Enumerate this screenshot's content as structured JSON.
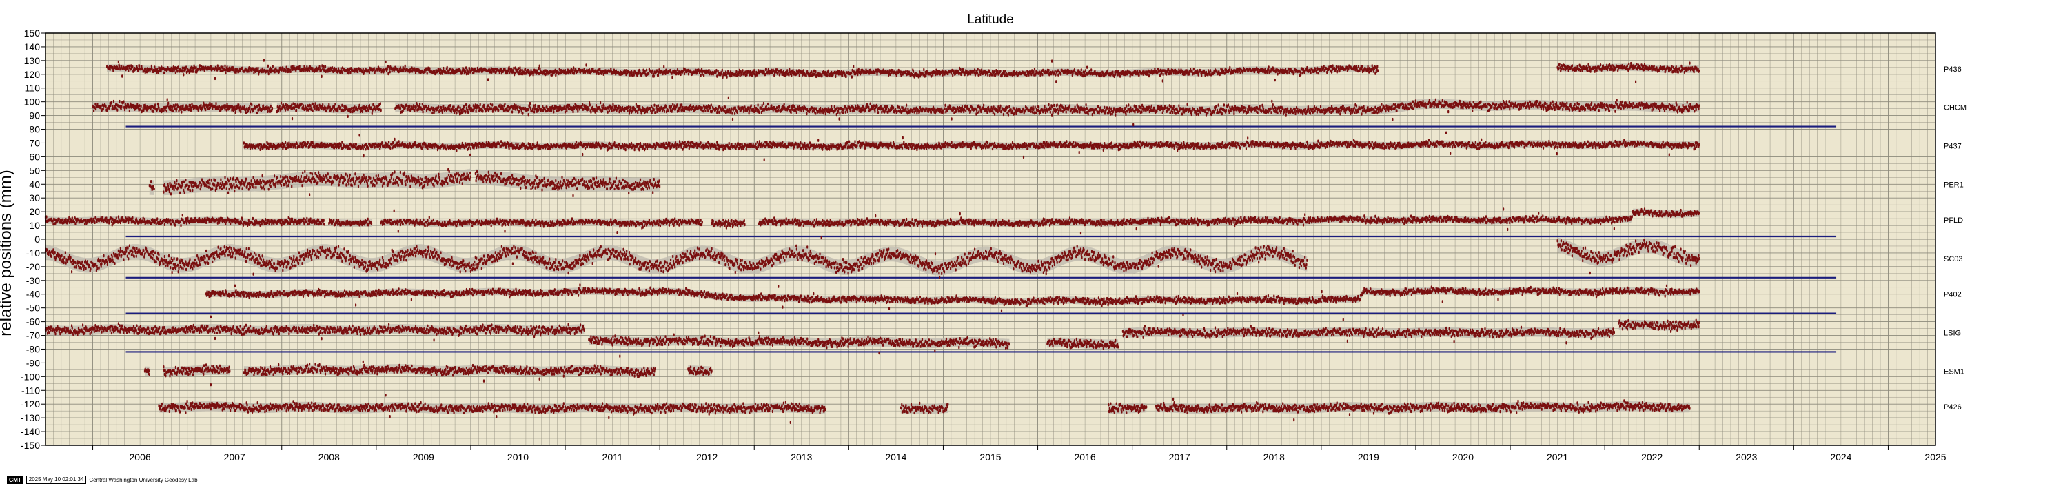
{
  "footer": {
    "logo": "GMT",
    "timestamp": "2025 May 10 02:01:34",
    "credit": "Central Washington University Geodesy Lab"
  },
  "colors": {
    "background": "#ece6cf",
    "grid": "#8d8a7c",
    "points": "#7a0f0f",
    "error_band": "#bdb8ad",
    "reference_lines": "#1b1e7d"
  },
  "chart_data": {
    "type": "scatter",
    "title": "Latitude",
    "xlabel": "",
    "ylabel": "relative positions (mm)",
    "xlim": [
      2005.5,
      2025.5
    ],
    "ylim": [
      -150,
      150
    ],
    "x_tick_labels": [
      "2006",
      "2007",
      "2008",
      "2009",
      "2010",
      "2011",
      "2012",
      "2013",
      "2014",
      "2015",
      "2016",
      "2017",
      "2018",
      "2019",
      "2020",
      "2021",
      "2022",
      "2023",
      "2024",
      "2025"
    ],
    "y_ticks": [
      150,
      140,
      130,
      120,
      110,
      100,
      90,
      80,
      70,
      60,
      50,
      40,
      30,
      20,
      10,
      0,
      -10,
      -20,
      -30,
      -40,
      -50,
      -60,
      -70,
      -80,
      -90,
      -100,
      -110,
      -120,
      -130,
      -140,
      -150
    ],
    "grid": true,
    "reference_lines": [
      {
        "y": 82,
        "x": [
          2006.35,
          2024.45
        ]
      },
      {
        "y": 2,
        "x": [
          2006.35,
          2024.45
        ]
      },
      {
        "y": -28,
        "x": [
          2006.35,
          2024.45
        ]
      },
      {
        "y": -54,
        "x": [
          2006.35,
          2024.45
        ]
      },
      {
        "y": -82,
        "x": [
          2006.35,
          2024.45
        ]
      }
    ],
    "series": [
      {
        "name": "P436",
        "offset": 124,
        "amplitude": 1.5,
        "noise": 1.5,
        "annual": 0,
        "segments": [
          [
            2006.15,
            2019.6
          ],
          [
            2021.5,
            2023.0
          ]
        ],
        "drift": [
          [
            2006.15,
            0
          ],
          [
            2009.0,
            -1
          ],
          [
            2013.0,
            -3
          ],
          [
            2017.0,
            -3
          ],
          [
            2019.6,
            0
          ],
          [
            2021.5,
            1
          ],
          [
            2023.0,
            0
          ]
        ]
      },
      {
        "name": "CHCM",
        "offset": 96,
        "amplitude": 1.5,
        "noise": 2,
        "annual": 0,
        "segments": [
          [
            2006.0,
            2007.9
          ],
          [
            2007.95,
            2009.05
          ],
          [
            2009.2,
            2023.0
          ]
        ],
        "drift": [
          [
            2006.0,
            0
          ],
          [
            2011.0,
            -1
          ],
          [
            2017.0,
            -2
          ],
          [
            2019.5,
            -2
          ],
          [
            2020.0,
            2
          ],
          [
            2023.0,
            0
          ]
        ]
      },
      {
        "name": "P437",
        "offset": 68,
        "amplitude": 1.5,
        "noise": 1.5,
        "annual": 0,
        "segments": [
          [
            2007.6,
            2023.0
          ]
        ],
        "drift": [
          [
            2007.6,
            0
          ],
          [
            2014.0,
            0
          ],
          [
            2023.0,
            1
          ]
        ]
      },
      {
        "name": "PER1",
        "offset": 40,
        "amplitude": 3,
        "noise": 3,
        "annual": 0,
        "segments": [
          [
            2006.6,
            2006.65
          ],
          [
            2006.75,
            2010.0
          ],
          [
            2010.05,
            2012.0
          ]
        ],
        "drift": [
          [
            2006.75,
            -2
          ],
          [
            2007.5,
            0
          ],
          [
            2008.5,
            4
          ],
          [
            2009.5,
            2
          ],
          [
            2010.0,
            6
          ],
          [
            2010.2,
            4
          ],
          [
            2011.0,
            0
          ],
          [
            2012.0,
            0
          ]
        ]
      },
      {
        "name": "PFLD",
        "offset": 14,
        "amplitude": 1.5,
        "noise": 1.5,
        "annual": 0,
        "segments": [
          [
            2005.5,
            2008.45
          ],
          [
            2008.5,
            2008.95
          ],
          [
            2009.05,
            2012.45
          ],
          [
            2012.55,
            2012.9
          ],
          [
            2013.05,
            2022.3
          ],
          [
            2022.3,
            2023.0
          ]
        ],
        "drift": [
          [
            2005.5,
            0
          ],
          [
            2009.0,
            -2
          ],
          [
            2016.0,
            -2
          ],
          [
            2019.0,
            0
          ],
          [
            2022.28,
            0
          ],
          [
            2022.3,
            5
          ],
          [
            2023.0,
            5
          ]
        ]
      },
      {
        "name": "SC03",
        "offset": -14,
        "amplitude": 5,
        "noise": 3,
        "annual": 1,
        "segments": [
          [
            2005.5,
            2018.85
          ],
          [
            2021.5,
            2023.0
          ]
        ],
        "drift": [
          [
            2005.5,
            0
          ],
          [
            2010.0,
            0
          ],
          [
            2015.0,
            -2
          ],
          [
            2018.85,
            0
          ],
          [
            2021.5,
            5
          ],
          [
            2023.0,
            4
          ]
        ]
      },
      {
        "name": "P402",
        "offset": -40,
        "amplitude": 1.5,
        "noise": 1.5,
        "annual": 0,
        "segments": [
          [
            2007.2,
            2023.0
          ]
        ],
        "drift": [
          [
            2007.2,
            0
          ],
          [
            2012.0,
            2
          ],
          [
            2013.0,
            -3
          ],
          [
            2016.0,
            -5
          ],
          [
            2019.4,
            -4
          ],
          [
            2019.45,
            2
          ],
          [
            2023.0,
            2
          ]
        ]
      },
      {
        "name": "LSIG",
        "offset": -68,
        "amplitude": 1.5,
        "noise": 2,
        "annual": 0,
        "segments": [
          [
            2005.5,
            2011.2
          ],
          [
            2011.25,
            2015.7
          ],
          [
            2016.1,
            2016.85
          ],
          [
            2016.9,
            2022.1
          ],
          [
            2022.15,
            2023.0
          ]
        ],
        "drift": [
          [
            2005.5,
            2
          ],
          [
            2011.2,
            2
          ],
          [
            2011.25,
            -6
          ],
          [
            2016.85,
            -8
          ],
          [
            2016.9,
            0
          ],
          [
            2022.1,
            0
          ],
          [
            2022.15,
            5
          ],
          [
            2023.0,
            6
          ]
        ]
      },
      {
        "name": "ESM1",
        "offset": -96,
        "amplitude": 1.5,
        "noise": 2,
        "annual": 0,
        "segments": [
          [
            2006.55,
            2006.6
          ],
          [
            2006.75,
            2007.45
          ],
          [
            2007.6,
            2011.95
          ],
          [
            2012.3,
            2012.55
          ]
        ],
        "drift": [
          [
            2006.75,
            0
          ],
          [
            2009.0,
            1
          ],
          [
            2011.95,
            0
          ]
        ]
      },
      {
        "name": "P426",
        "offset": -122,
        "amplitude": 1.5,
        "noise": 2,
        "annual": 0,
        "segments": [
          [
            2006.7,
            2013.75
          ],
          [
            2014.55,
            2015.05
          ],
          [
            2016.75,
            2017.15
          ],
          [
            2017.25,
            2022.9
          ]
        ],
        "drift": [
          [
            2006.7,
            0
          ],
          [
            2010.0,
            -1
          ],
          [
            2017.0,
            -1
          ],
          [
            2022.9,
            0
          ]
        ]
      }
    ]
  }
}
